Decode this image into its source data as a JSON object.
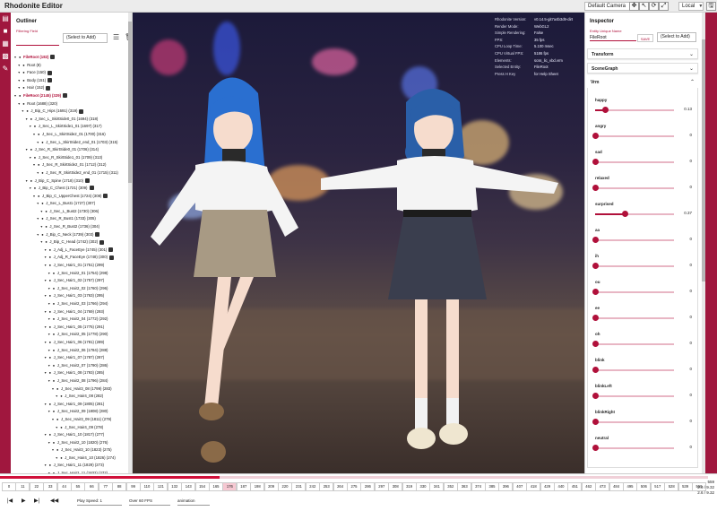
{
  "app": {
    "title": "Rhodonite Editor"
  },
  "topbar": {
    "camera_select": "Default Camera",
    "space_select": "Local",
    "tools": [
      {
        "name": "move-tool-icon",
        "glyph": "✥"
      },
      {
        "name": "select-tool-icon",
        "glyph": "↖"
      },
      {
        "name": "rotate-tool-icon",
        "glyph": "⟳"
      },
      {
        "name": "scale-tool-icon",
        "glyph": "⤢"
      },
      {
        "name": "save-icon",
        "glyph": "🖫"
      }
    ]
  },
  "iconbar": {
    "icons": [
      {
        "name": "file-icon",
        "glyph": "▤"
      },
      {
        "name": "camera-icon",
        "glyph": "■"
      },
      {
        "name": "image-icon",
        "glyph": "▦"
      },
      {
        "name": "grid-icon",
        "glyph": "▩"
      },
      {
        "name": "wrench-icon",
        "glyph": "✎"
      }
    ]
  },
  "outliner": {
    "title": "Outliner",
    "filter_label": "Filtering Field",
    "filter_select": "(Select to Add)",
    "tree": [
      {
        "level": 0,
        "label": "FileRoot (182)",
        "root": true,
        "extra": true
      },
      {
        "level": 1,
        "label": "Root (8)"
      },
      {
        "level": 1,
        "label": "Face (150)",
        "extra": true
      },
      {
        "level": 1,
        "label": "Body (151)",
        "extra": true
      },
      {
        "level": 1,
        "label": "Hair (152)",
        "extra": true
      },
      {
        "level": 0,
        "label": "FileRoot (2145) (329)",
        "root": true,
        "extra": true
      },
      {
        "level": 1,
        "label": "Root (1688) (320)"
      },
      {
        "level": 2,
        "label": "J_Bip_C_Hips (1691) (319)",
        "extra": true
      },
      {
        "level": 3,
        "label": "J_Sec_L_SkirtSide0_01 (1694) (318)"
      },
      {
        "level": 4,
        "label": "J_Sec_L_SkirtSide1_01 (1697) (317)"
      },
      {
        "level": 5,
        "label": "J_Sec_L_SkirtSide2_01 (1700) (316)"
      },
      {
        "level": 6,
        "label": "J_Sec_L_SkirtSide2_end_01 (1703) (315)"
      },
      {
        "level": 3,
        "label": "J_Sec_R_SkirtSide0_01 (1706) (314)"
      },
      {
        "level": 4,
        "label": "J_Sec_R_SkirtSide1_01 (1709) (313)"
      },
      {
        "level": 5,
        "label": "J_Sec_R_SkirtSide2_01 (1712) (312)"
      },
      {
        "level": 6,
        "label": "J_Sec_R_SkirtSide2_end_01 (1715) (311)"
      },
      {
        "level": 3,
        "label": "J_Bip_C_Spine (1718) (310)",
        "extra": true
      },
      {
        "level": 4,
        "label": "J_Bip_C_Chest (1721) (309)",
        "extra": true
      },
      {
        "level": 5,
        "label": "J_Bip_C_UpperChest (1724) (308)",
        "extra": true
      },
      {
        "level": 6,
        "label": "J_Sec_L_Bust1 (1727) (307)"
      },
      {
        "level": 7,
        "label": "J_Sec_L_Bust2 (1730) (306)"
      },
      {
        "level": 6,
        "label": "J_Sec_R_Bust1 (1733) (305)"
      },
      {
        "level": 7,
        "label": "J_Sec_R_Bust2 (1736) (304)"
      },
      {
        "level": 6,
        "label": "J_Bip_C_Neck (1739) (303)",
        "extra": true
      },
      {
        "level": 7,
        "label": "J_Bip_C_Head (1742) (302)",
        "extra": true
      },
      {
        "level": 8,
        "label": "J_Adj_L_FaceEye (1745) (301)",
        "extra": true
      },
      {
        "level": 8,
        "label": "J_Adj_R_FaceEye (1748) (300)",
        "extra": true
      },
      {
        "level": 8,
        "label": "J_Sec_Hair1_01 (1751) (299)"
      },
      {
        "level": 9,
        "label": "J_Sec_Hair2_01 (1754) (298)"
      },
      {
        "level": 8,
        "label": "J_Sec_Hair1_02 (1757) (297)"
      },
      {
        "level": 9,
        "label": "J_Sec_Hair2_02 (1760) (296)"
      },
      {
        "level": 8,
        "label": "J_Sec_Hair1_03 (1763) (295)"
      },
      {
        "level": 9,
        "label": "J_Sec_Hair2_03 (1766) (294)"
      },
      {
        "level": 8,
        "label": "J_Sec_Hair1_04 (1769) (293)"
      },
      {
        "level": 9,
        "label": "J_Sec_Hair2_04 (1772) (292)"
      },
      {
        "level": 8,
        "label": "J_Sec_Hair1_05 (1775) (291)"
      },
      {
        "level": 9,
        "label": "J_Sec_Hair2_05 (1778) (290)"
      },
      {
        "level": 8,
        "label": "J_Sec_Hair1_06 (1781) (289)"
      },
      {
        "level": 9,
        "label": "J_Sec_Hair2_06 (1784) (288)"
      },
      {
        "level": 8,
        "label": "J_Sec_Hair1_07 (1787) (287)"
      },
      {
        "level": 9,
        "label": "J_Sec_Hair2_07 (1790) (286)"
      },
      {
        "level": 8,
        "label": "J_Sec_Hair1_08 (1793) (285)"
      },
      {
        "level": 9,
        "label": "J_Sec_Hair2_08 (1796) (284)"
      },
      {
        "level": 10,
        "label": "J_Sec_Hair3_08 (1799) (283)"
      },
      {
        "level": 11,
        "label": "J_Sec_Hair4_08 (282)"
      },
      {
        "level": 8,
        "label": "J_Sec_Hair1_09 (1805) (281)"
      },
      {
        "level": 9,
        "label": "J_Sec_Hair2_09 (1808) (280)"
      },
      {
        "level": 10,
        "label": "J_Sec_Hair3_09 (1811) (279)"
      },
      {
        "level": 11,
        "label": "J_Sec_Hair4_09 (278)"
      },
      {
        "level": 8,
        "label": "J_Sec_Hair1_10 (1817) (277)"
      },
      {
        "level": 9,
        "label": "J_Sec_Hair2_10 (1820) (276)"
      },
      {
        "level": 10,
        "label": "J_Sec_Hair3_10 (1823) (275)"
      },
      {
        "level": 11,
        "label": "J_Sec_Hair4_10 (1826) (274)"
      },
      {
        "level": 8,
        "label": "J_Sec_Hair1_11 (1829) (273)"
      },
      {
        "level": 9,
        "label": "J_Sec_Hair2_11 (1832) (272)"
      },
      {
        "level": 10,
        "label": "J_Sec_Hair3_11 (1835) (271)"
      }
    ]
  },
  "viewport": {
    "stats": [
      {
        "k": "Rhodonite Version:",
        "v": "v0.14.5-git7a4b3d9-dirt"
      },
      {
        "k": "Render Mode:",
        "v": "WebGL2"
      },
      {
        "k": "Simple Rendering:",
        "v": "False"
      },
      {
        "k": "FPS:",
        "v": "35 fps"
      },
      {
        "k": "CPU Loop Time:",
        "v": "5.100 msec"
      },
      {
        "k": "CPU Virtual FPS:",
        "v": "5186 fps"
      },
      {
        "k": "Elements:",
        "v": "scss_lic_vbd.vrm"
      },
      {
        "k": "Selected Entity:",
        "v": "FileRoot"
      },
      {
        "k": "Press H Key",
        "v": "for Help Sheet"
      }
    ]
  },
  "inspector": {
    "title": "Inspector",
    "entity_label": "Entity Unique Name",
    "entity_value": "FileRoot",
    "save_label": "SAVE",
    "add_select": "(Select to Add)",
    "sections": [
      {
        "title": "Transform"
      },
      {
        "title": "SceneGraph"
      }
    ],
    "vrm_title": "Vrm",
    "sliders": [
      {
        "label": "happy",
        "value": 0.13,
        "display": "0.13"
      },
      {
        "label": "angry",
        "value": 0,
        "display": "0"
      },
      {
        "label": "sad",
        "value": 0,
        "display": "0"
      },
      {
        "label": "relaxed",
        "value": 0,
        "display": "0"
      },
      {
        "label": "surprised",
        "value": 0.37,
        "display": "0.37"
      },
      {
        "label": "aa",
        "value": 0,
        "display": "0"
      },
      {
        "label": "ih",
        "value": 0,
        "display": "0"
      },
      {
        "label": "ou",
        "value": 0,
        "display": "0"
      },
      {
        "label": "ee",
        "value": 0,
        "display": "0"
      },
      {
        "label": "oh",
        "value": 0,
        "display": "0"
      },
      {
        "label": "blink",
        "value": 0,
        "display": "0"
      },
      {
        "label": "blinkLeft",
        "value": 0,
        "display": "0"
      },
      {
        "label": "blinkRight",
        "value": 0,
        "display": "0"
      },
      {
        "label": "neutral",
        "value": 0,
        "display": "0"
      }
    ]
  },
  "timeline": {
    "progress": 0.31,
    "current_frame": "176",
    "frames": [
      "0",
      "11",
      "22",
      "33",
      "44",
      "55",
      "66",
      "77",
      "88",
      "99",
      "110",
      "121",
      "132",
      "143",
      "154",
      "165",
      "176",
      "187",
      "198",
      "209",
      "220",
      "231",
      "242",
      "253",
      "264",
      "275",
      "286",
      "297",
      "308",
      "319",
      "330",
      "341",
      "352",
      "363",
      "374",
      "385",
      "396",
      "407",
      "418",
      "429",
      "440",
      "451",
      "462",
      "473",
      "484",
      "495",
      "506",
      "517",
      "528",
      "539",
      "550"
    ],
    "end_frame": "559",
    "end_time": "2.9 / 9.32",
    "end_sub": "2.6 / 9.32",
    "controls": {
      "prev_label": "|◀",
      "play_label": "▶",
      "next_label": "▶|",
      "skip_label": "◀◀",
      "speed_select": "Play Speed: 1",
      "fps_select": "Over 60 FPS",
      "anim_select": "animation"
    }
  },
  "colors": {
    "accent": "#b0103a",
    "sidebar": "#a0173e"
  }
}
